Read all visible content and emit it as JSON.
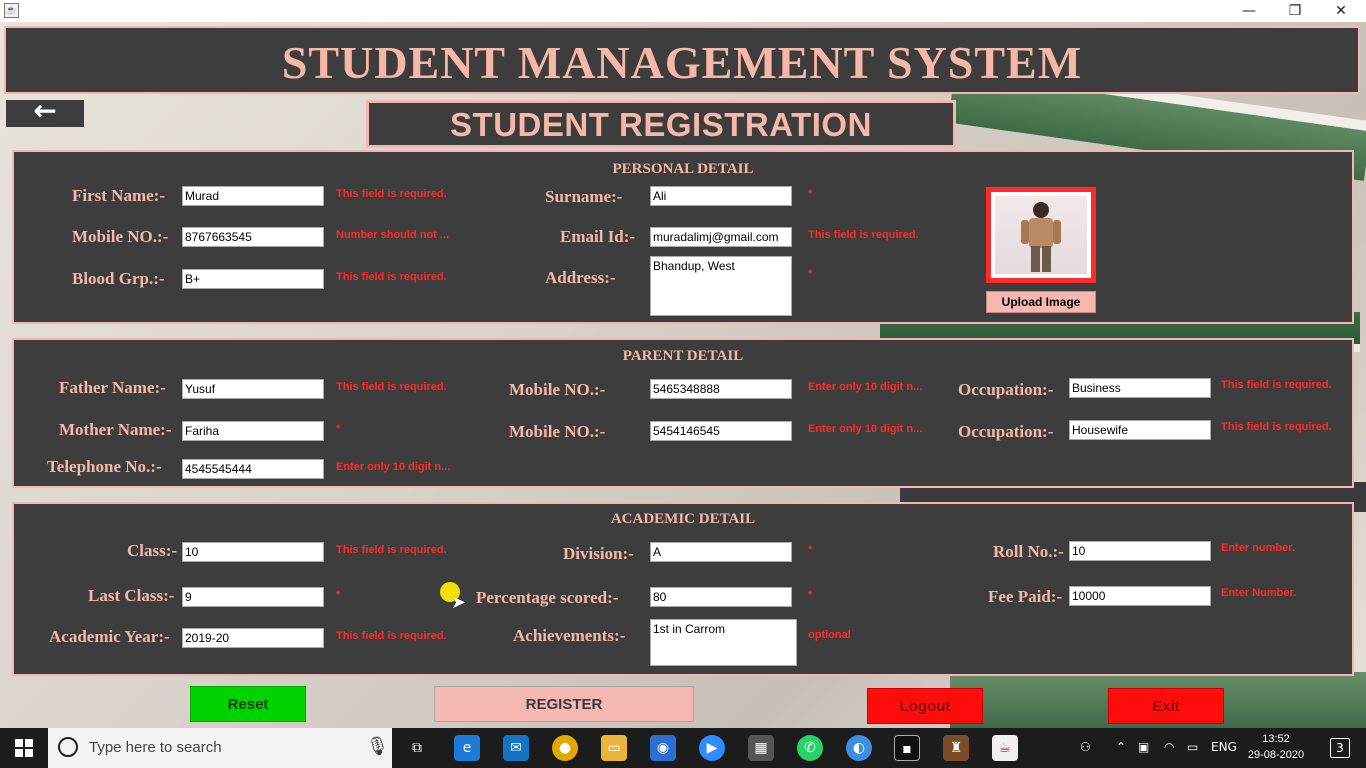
{
  "window": {
    "minimize": "—",
    "maximize": "❐",
    "close": "✕"
  },
  "header": {
    "title": "STUDENT MANAGEMENT SYSTEM"
  },
  "back": {
    "label": "←"
  },
  "subheader": {
    "title": "STUDENT REGISTRATION"
  },
  "personal": {
    "title": "PERSONAL DETAIL",
    "first_name": {
      "label": "First Name:-",
      "value": "Murad",
      "error": "This field is required."
    },
    "mobile": {
      "label": "Mobile NO.:-",
      "value": "8767663545",
      "error": "Number should not ..."
    },
    "blood": {
      "label": "Blood Grp.:-",
      "value": "B+",
      "error": "This field is required."
    },
    "surname": {
      "label": "Surname:-",
      "value": "Ali",
      "error": "*"
    },
    "email": {
      "label": "Email Id:-",
      "value": "muradalimj@gmail.com",
      "error": "This field is required."
    },
    "address": {
      "label": "Address:-",
      "value": "Bhandup, West",
      "error": "*"
    },
    "upload": "Upload Image"
  },
  "parent": {
    "title": "PARENT DETAIL",
    "father": {
      "label": "Father Name:-",
      "value": "Yusuf",
      "error": "This field is required."
    },
    "mother": {
      "label": "Mother Name:-",
      "value": "Fariha",
      "error": "*"
    },
    "telephone": {
      "label": "Telephone No.:-",
      "value": "4545545444",
      "error": "Enter only 10 digit n..."
    },
    "father_mobile": {
      "label": "Mobile NO.:-",
      "value": "5465348888",
      "error": "Enter only 10 digit n..."
    },
    "mother_mobile": {
      "label": "Mobile NO.:-",
      "value": "5454146545",
      "error": "Enter only 10 digit n..."
    },
    "father_occupation": {
      "label": "Occupation:-",
      "value": "Business",
      "error": "This field is required."
    },
    "mother_occupation": {
      "label": "Occupation:-",
      "value": "Housewife",
      "error": "This field is required."
    }
  },
  "academic": {
    "title": "ACADEMIC DETAIL",
    "class": {
      "label": "Class:-",
      "value": "10",
      "error": "This field is required."
    },
    "last_class": {
      "label": "Last Class:-",
      "value": "9",
      "error": "*"
    },
    "year": {
      "label": "Academic Year:-",
      "value": "2019-20",
      "error": "This field is required."
    },
    "division": {
      "label": "Division:-",
      "value": "A",
      "error": "*"
    },
    "percentage": {
      "label": "Percentage scored:-",
      "value": "80",
      "error": "*"
    },
    "achievements": {
      "label": "Achievements:-",
      "value": "1st in Carrom",
      "error": "optional"
    },
    "roll": {
      "label": "Roll No.:-",
      "value": "10",
      "error": "Enter number."
    },
    "fee": {
      "label": "Fee Paid:-",
      "value": "10000",
      "error": "Enter Number."
    }
  },
  "buttons": {
    "reset": "Reset",
    "register": "REGISTER",
    "logout": "Logout",
    "exit": "Exit"
  },
  "taskbar": {
    "search_placeholder": "Type here to search",
    "language": "ENG",
    "time": "13:52",
    "date": "29-08-2020",
    "notifications": "3"
  }
}
